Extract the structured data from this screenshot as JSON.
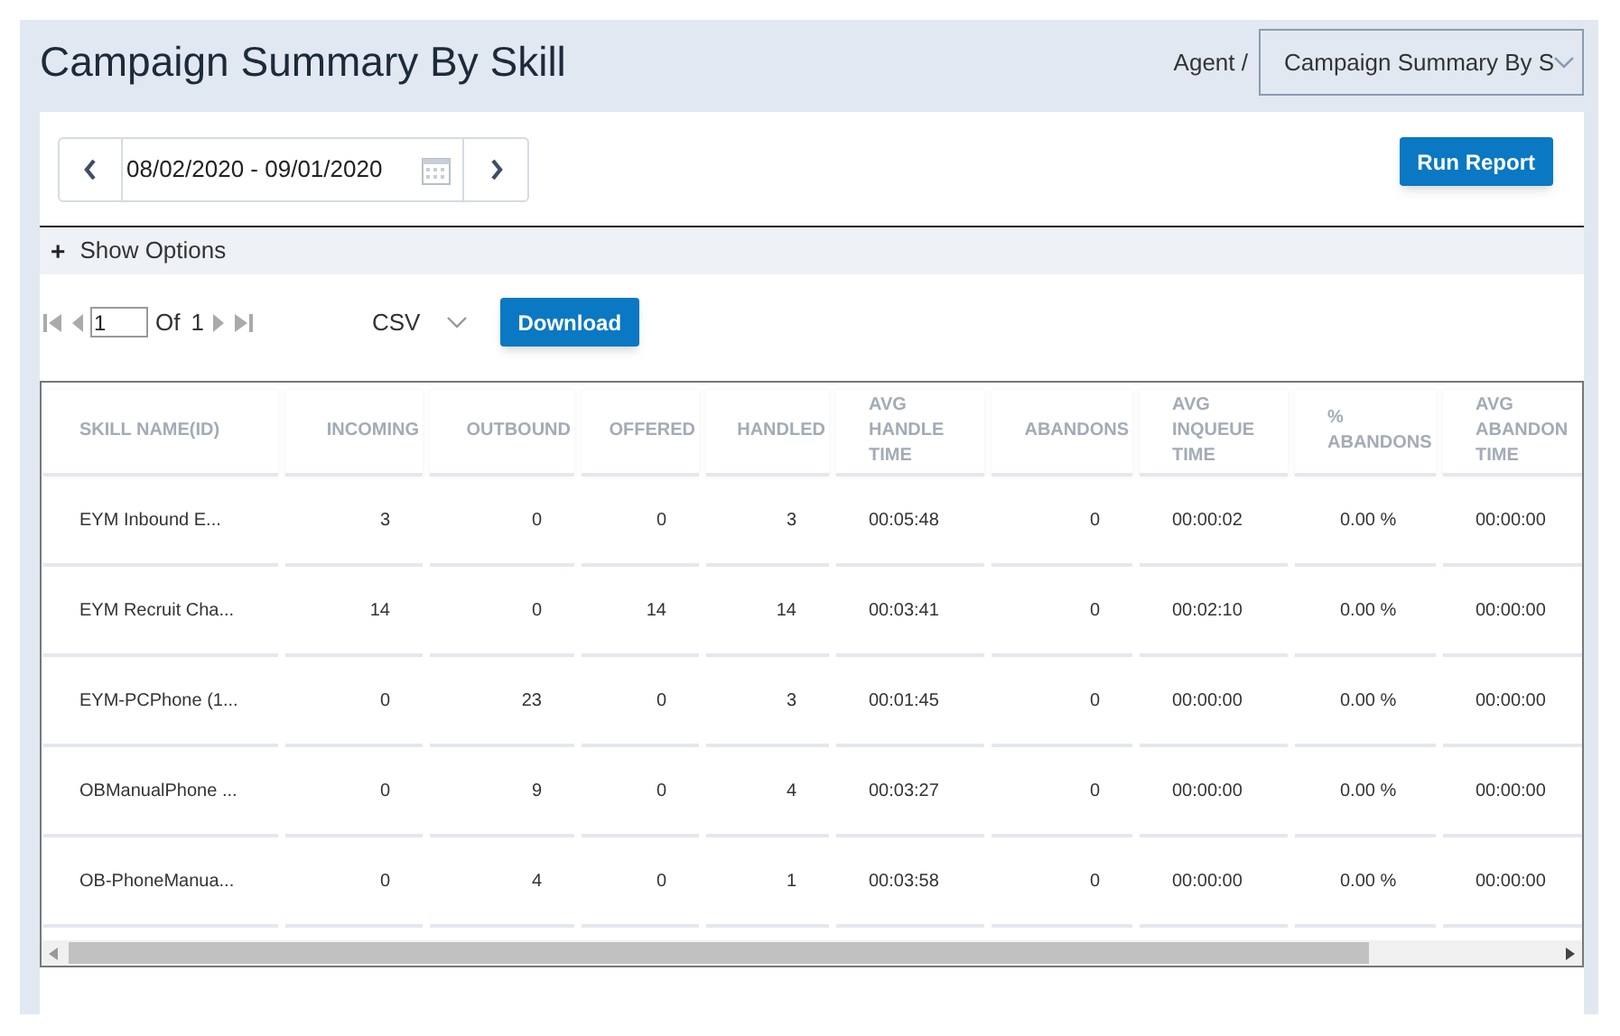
{
  "header": {
    "title": "Campaign Summary By Skill",
    "breadcrumb": "Agent /",
    "report_select": "Campaign Summary By S"
  },
  "date_range": {
    "value": "08/02/2020 - 09/01/2020"
  },
  "run_button": "Run Report",
  "options": {
    "label": "Show Options",
    "toggle": "+"
  },
  "pager": {
    "page": "1",
    "of_label": "Of",
    "total": "1"
  },
  "export": {
    "format": "CSV",
    "button": "Download"
  },
  "table": {
    "columns": [
      "SKILL NAME(ID)",
      "INCOMING",
      "OUTBOUND",
      "OFFERED",
      "HANDLED",
      "AVG HANDLE TIME",
      "ABANDONS",
      "AVG INQUEUE TIME",
      "% ABANDONS",
      "AVG ABANDON TIME"
    ],
    "rows": [
      [
        "EYM Inbound E...",
        "3",
        "0",
        "0",
        "3",
        "00:05:48",
        "0",
        "00:00:02",
        "0.00 %",
        "00:00:00"
      ],
      [
        "EYM Recruit Cha...",
        "14",
        "0",
        "14",
        "14",
        "00:03:41",
        "0",
        "00:02:10",
        "0.00 %",
        "00:00:00"
      ],
      [
        "EYM-PCPhone (1...",
        "0",
        "23",
        "0",
        "3",
        "00:01:45",
        "0",
        "00:00:00",
        "0.00 %",
        "00:00:00"
      ],
      [
        "OBManualPhone ...",
        "0",
        "9",
        "0",
        "4",
        "00:03:27",
        "0",
        "00:00:00",
        "0.00 %",
        "00:00:00"
      ],
      [
        "OB-PhoneManua...",
        "0",
        "4",
        "0",
        "1",
        "00:03:58",
        "0",
        "00:00:00",
        "0.00 %",
        "00:00:00"
      ]
    ]
  }
}
